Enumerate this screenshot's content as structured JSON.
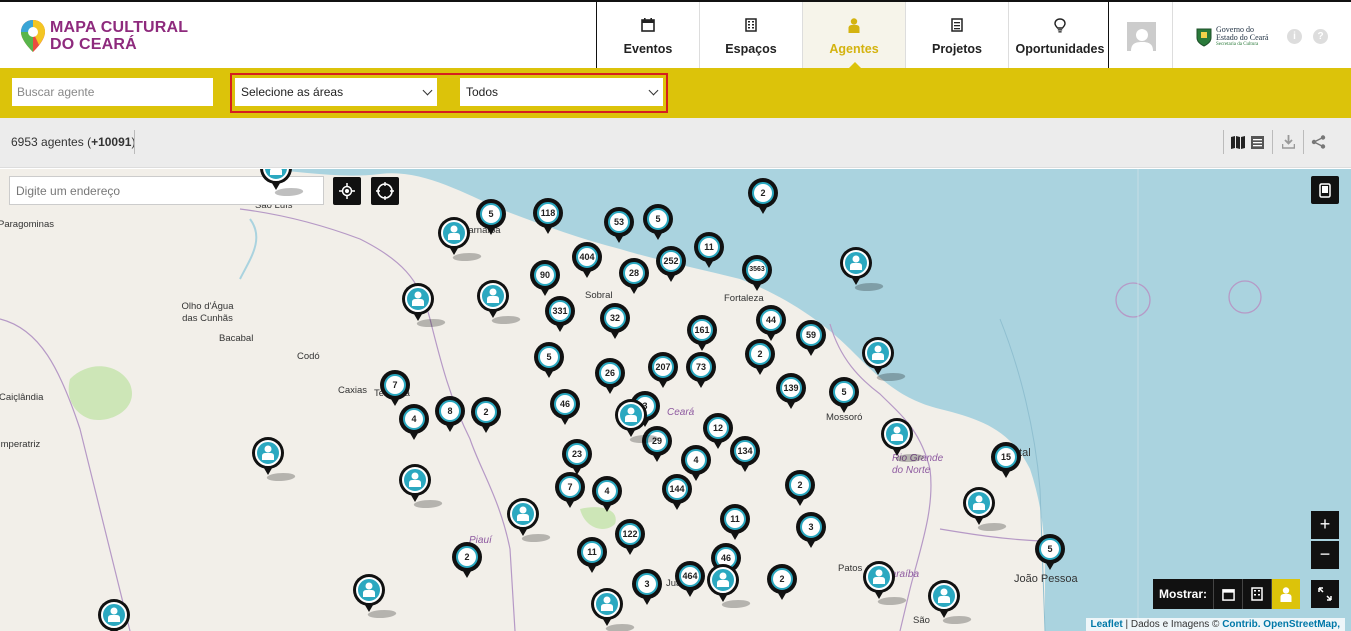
{
  "app": {
    "logo_line1": "MAPA CULTURAL",
    "logo_line2": "DO CEARÁ",
    "gov_line1": "Governo do",
    "gov_line2": "Estado do Ceará",
    "gov_line3": "Secretaria da Cultura"
  },
  "nav": [
    {
      "label": "Eventos",
      "icon": "calendar-icon"
    },
    {
      "label": "Espaços",
      "icon": "building-icon"
    },
    {
      "label": "Agentes",
      "icon": "person-icon",
      "active": true
    },
    {
      "label": "Projetos",
      "icon": "document-icon"
    },
    {
      "label": "Oportunidades",
      "icon": "lightbulb-icon"
    }
  ],
  "header_icons": {
    "info": "i",
    "help": "?"
  },
  "filters": {
    "search_placeholder": "Buscar agente",
    "areas_label": "Selecione as áreas",
    "type_label": "Todos"
  },
  "results": {
    "count": "6953 agentes",
    "extra": "+10091"
  },
  "map": {
    "address_placeholder": "Digite um endereço",
    "show_label": "Mostrar:",
    "zoom_in": "+",
    "zoom_out": "−",
    "attribution_leaflet": "Leaflet",
    "attribution_text": " | Dados e Imagens © ",
    "attribution_contrib": "Contrib. OpenStreetMap,",
    "places": [
      "São Luís",
      "Paragominas",
      "Olho d'Água das Cunhãs",
      "Bacabal",
      "Codó",
      "Caxias",
      "Teresina",
      "Caiçlândia",
      "Imperatriz",
      "Sobral",
      "Fortaleza",
      "Ceará",
      "Mossoró",
      "Rio Grande do Norte",
      "Natal",
      "Piauí",
      "Patos",
      "Paraíba",
      "João Pessoa",
      "Parnaíba",
      "Juazeiro",
      "São"
    ],
    "clusters": [
      "2",
      "5",
      "118",
      "53",
      "5",
      "11",
      "404",
      "252",
      "90",
      "28",
      "3563",
      "331",
      "32",
      "44",
      "161",
      "59",
      "5",
      "26",
      "207",
      "73",
      "2",
      "139",
      "5",
      "7",
      "8",
      "2",
      "4",
      "46",
      "3",
      "12",
      "29",
      "4",
      "134",
      "23",
      "15",
      "7",
      "4",
      "144",
      "2",
      "11",
      "122",
      "3",
      "11",
      "46",
      "2",
      "464",
      "2",
      "3",
      "5"
    ],
    "agent_markers": 14
  }
}
